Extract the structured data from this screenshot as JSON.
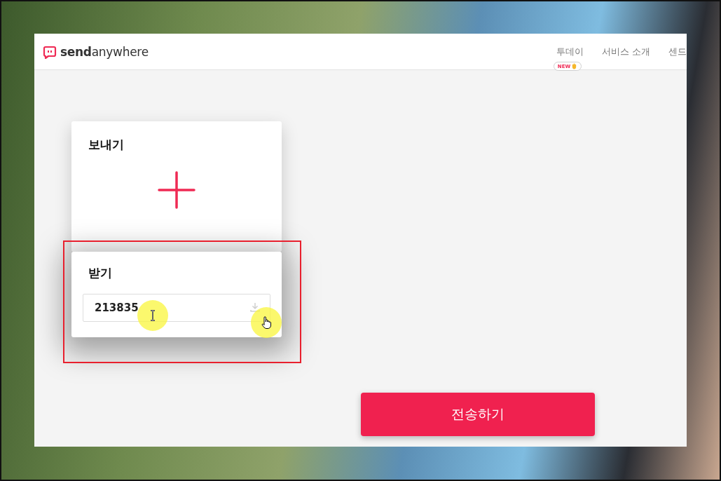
{
  "logo": {
    "text": "**send**anywhere"
  },
  "nav": [
    {
      "label": "투데이",
      "badge": "NEW"
    },
    {
      "label": "서비스 소개"
    },
    {
      "label": "센드"
    }
  ],
  "send_card": {
    "title": "보내기"
  },
  "receive_card": {
    "title": "받기",
    "value": "213835"
  },
  "transfer_button": {
    "label": "전송하기"
  }
}
